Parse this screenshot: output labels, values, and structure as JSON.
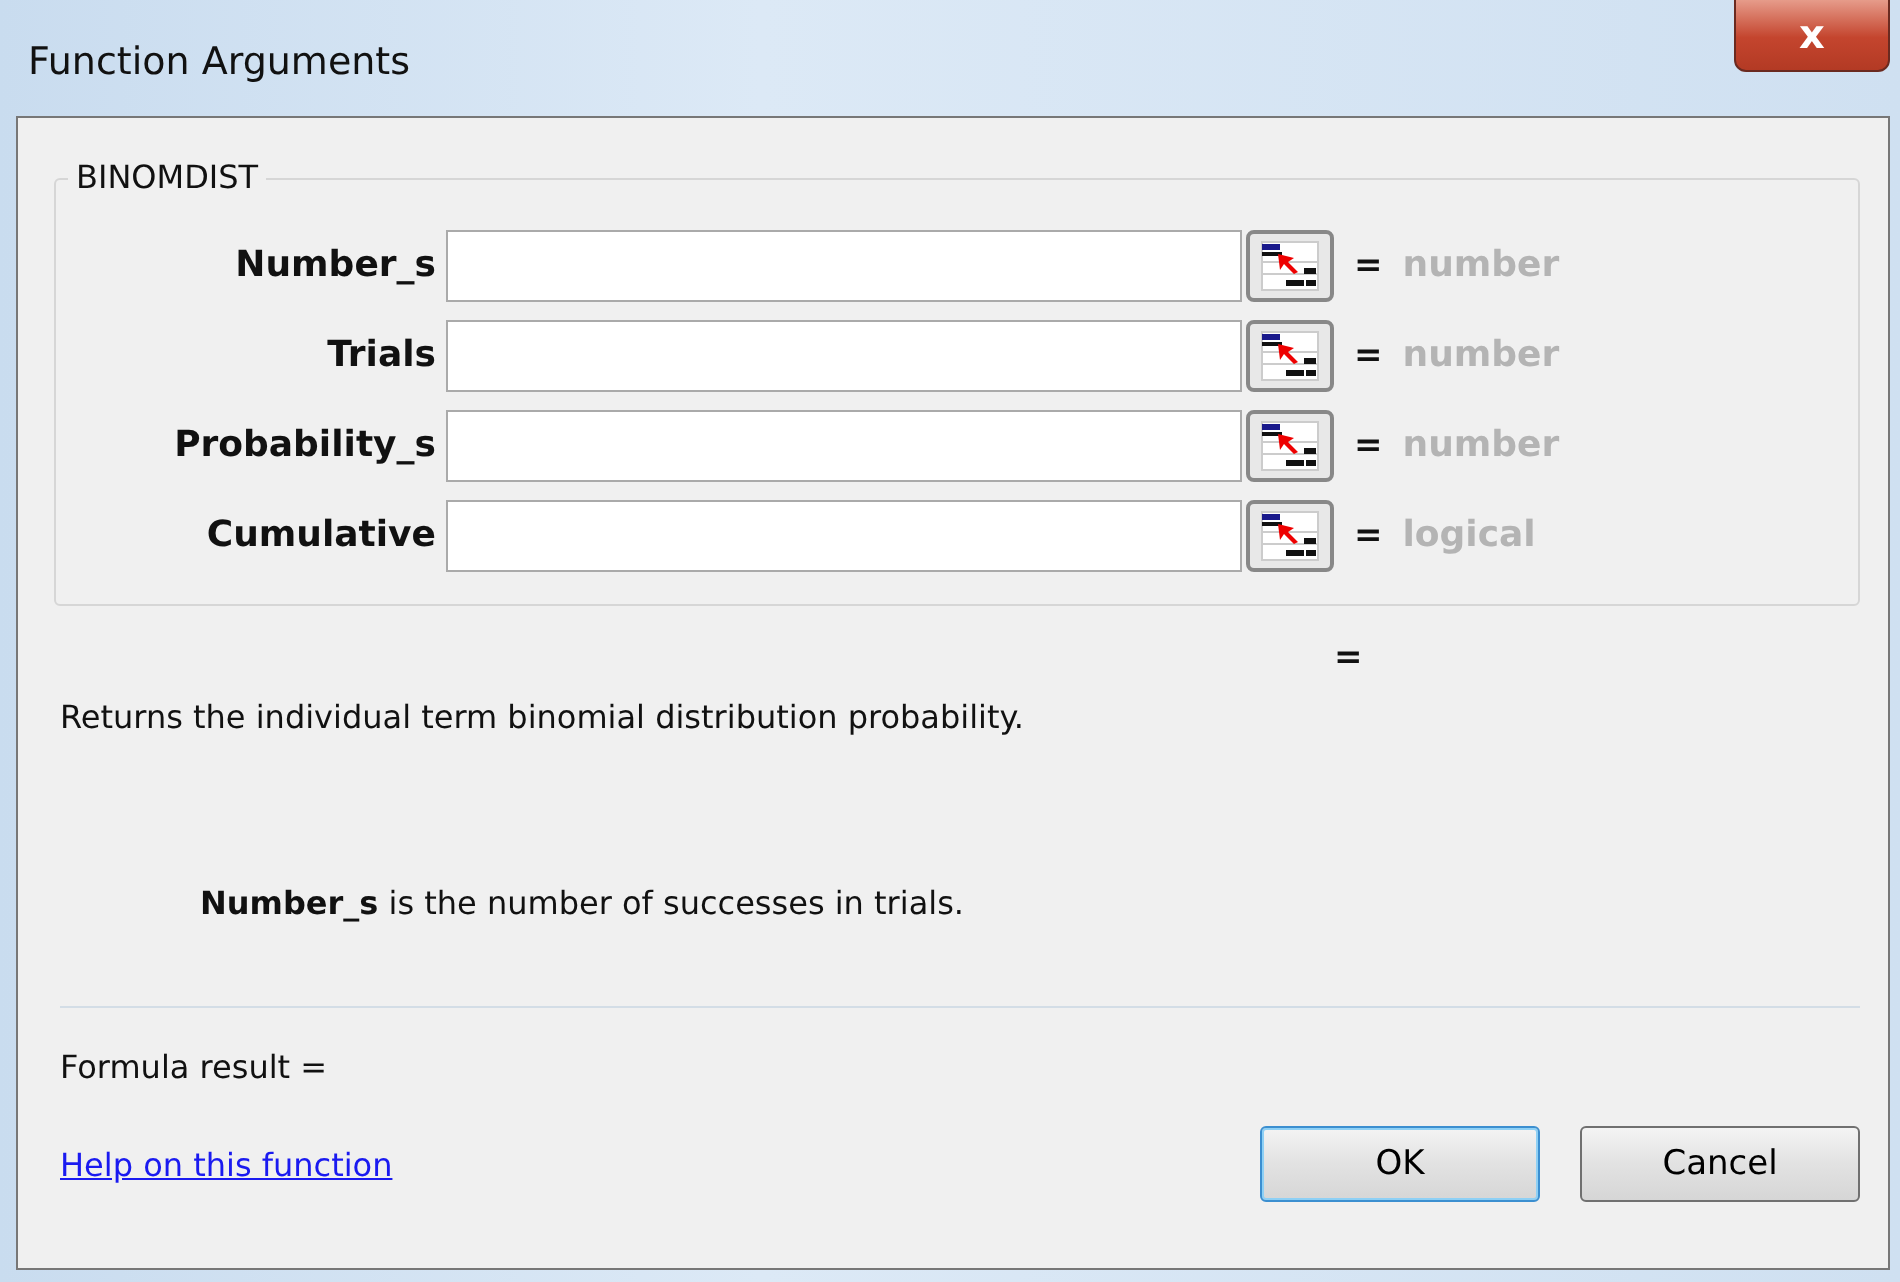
{
  "window": {
    "title": "Function Arguments",
    "close": "x"
  },
  "function_name": "BINOMDIST",
  "arguments": [
    {
      "label": "Number_s",
      "equals": "=",
      "hint": "number"
    },
    {
      "label": "Trials",
      "equals": "=",
      "hint": "number"
    },
    {
      "label": "Probability_s",
      "equals": "=",
      "hint": "number"
    },
    {
      "label": "Cumulative",
      "equals": "=",
      "hint": "logical"
    }
  ],
  "result_equals": "=",
  "description": "Returns the individual term binomial distribution probability.",
  "argument_help": "**Number_s** is the number of successes in trials.",
  "formula_result": "Formula result =",
  "help_link": "Help on this function",
  "buttons": [
    {
      "label": "OK",
      "default": true
    },
    {
      "label": "Cancel",
      "default": false
    }
  ]
}
